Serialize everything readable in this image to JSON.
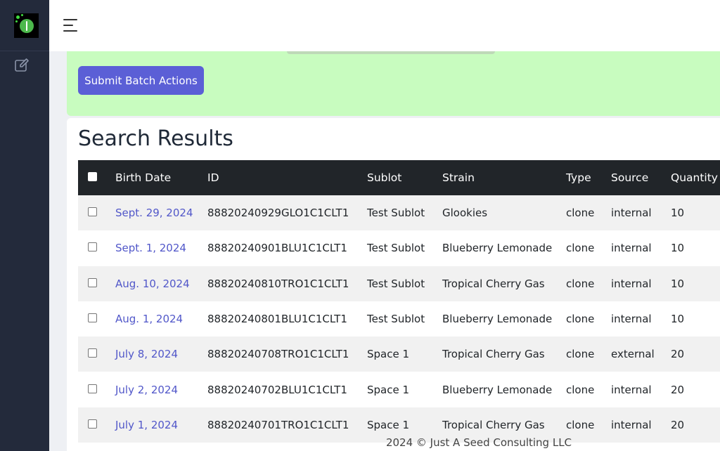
{
  "sidebar": {
    "logo_icon": "seed-leaf-logo-icon",
    "nav_icon": "edit-icon"
  },
  "topbar": {
    "menu_icon": "hamburger-menu-icon"
  },
  "batch": {
    "submit_label": "Submit Batch Actions"
  },
  "results": {
    "title": "Search Results",
    "columns": [
      "Birth Date",
      "ID",
      "Sublot",
      "Strain",
      "Type",
      "Source",
      "Quantity"
    ],
    "rows": [
      {
        "birth_date": "Sept. 29, 2024",
        "id": "88820240929GLO1C1CLT1",
        "sublot": "Test Sublot",
        "strain": "Glookies",
        "type": "clone",
        "source": "internal",
        "quantity": "10"
      },
      {
        "birth_date": "Sept. 1, 2024",
        "id": "88820240901BLU1C1CLT1",
        "sublot": "Test Sublot",
        "strain": "Blueberry Lemonade",
        "type": "clone",
        "source": "internal",
        "quantity": "10"
      },
      {
        "birth_date": "Aug. 10, 2024",
        "id": "88820240810TRO1C1CLT1",
        "sublot": "Test Sublot",
        "strain": "Tropical Cherry Gas",
        "type": "clone",
        "source": "internal",
        "quantity": "10"
      },
      {
        "birth_date": "Aug. 1, 2024",
        "id": "88820240801BLU1C1CLT1",
        "sublot": "Test Sublot",
        "strain": "Blueberry Lemonade",
        "type": "clone",
        "source": "internal",
        "quantity": "10"
      },
      {
        "birth_date": "July 8, 2024",
        "id": "88820240708TRO1C1CLT1",
        "sublot": "Space 1",
        "strain": "Tropical Cherry Gas",
        "type": "clone",
        "source": "external",
        "quantity": "20"
      },
      {
        "birth_date": "July 2, 2024",
        "id": "88820240702BLU1C1CLT1",
        "sublot": "Space 1",
        "strain": "Blueberry Lemonade",
        "type": "clone",
        "source": "internal",
        "quantity": "20"
      },
      {
        "birth_date": "July 1, 2024",
        "id": "88820240701TRO1C1CLT1",
        "sublot": "Space 1",
        "strain": "Tropical Cherry Gas",
        "type": "clone",
        "source": "internal",
        "quantity": "20"
      }
    ]
  },
  "footer": {
    "text": "2024 © Just A Seed Consulting LLC"
  },
  "colors": {
    "sidebar_bg": "#232a3b",
    "panel_green": "#c8fcbf",
    "button_accent": "#5b5fd6",
    "link": "#5157c9",
    "table_header": "#212529"
  }
}
